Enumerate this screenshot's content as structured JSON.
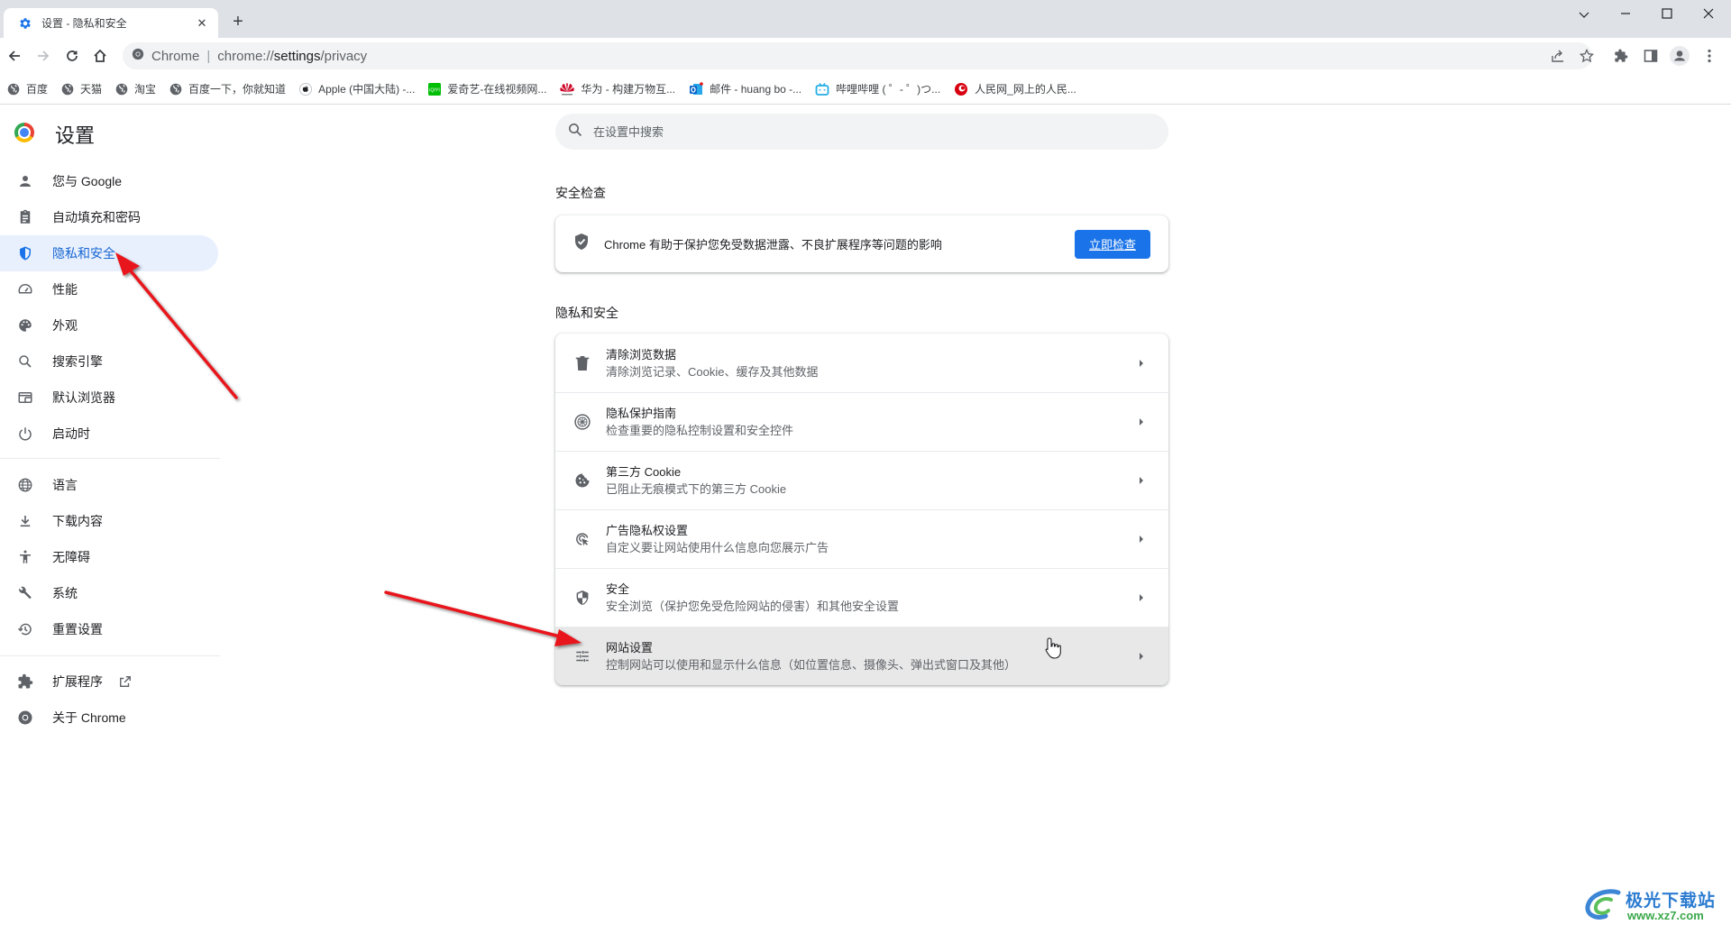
{
  "browser": {
    "tab_title": "设置 - 隐私和安全",
    "tab_icon": "gear-icon",
    "new_tab_label": "+",
    "omnibox": {
      "site_name": "Chrome",
      "separator": "|",
      "url_prefix": "chrome://",
      "url_host": "settings",
      "url_path": "/privacy"
    },
    "bookmarks": [
      {
        "label": "百度",
        "icon": "globe-icon",
        "color": "#5f6368"
      },
      {
        "label": "天猫",
        "icon": "globe-icon",
        "color": "#5f6368"
      },
      {
        "label": "淘宝",
        "icon": "globe-icon",
        "color": "#5f6368"
      },
      {
        "label": "百度一下，你就知道",
        "icon": "globe-icon",
        "color": "#5f6368"
      },
      {
        "label": "Apple (中国大陆) -...",
        "icon": "apple-icon",
        "color": "#3c4043"
      },
      {
        "label": "爱奇艺-在线视频网...",
        "icon": "iqiyi-icon",
        "color": "#00be06"
      },
      {
        "label": "华为 - 构建万物互...",
        "icon": "huawei-icon",
        "color": "#cf0a2c"
      },
      {
        "label": "邮件 - huang bo -...",
        "icon": "outlook-icon",
        "color": "#0a64c8"
      },
      {
        "label": "哔哩哔哩 ( ゜- ゜)つ...",
        "icon": "bilibili-icon",
        "color": "#23ade5"
      },
      {
        "label": "人民网_网上的人民...",
        "icon": "people-daily-icon",
        "color": "#d7000f"
      }
    ]
  },
  "settings": {
    "title": "设置",
    "search_placeholder": "在设置中搜索",
    "sidebar": [
      {
        "label": "您与 Google",
        "icon": "person-icon",
        "active": false
      },
      {
        "label": "自动填充和密码",
        "icon": "clipboard-icon",
        "active": false
      },
      {
        "label": "隐私和安全",
        "icon": "shield-icon",
        "active": true
      },
      {
        "label": "性能",
        "icon": "speedometer-icon",
        "active": false
      },
      {
        "label": "外观",
        "icon": "palette-icon",
        "active": false
      },
      {
        "label": "搜索引擎",
        "icon": "search-icon",
        "active": false
      },
      {
        "label": "默认浏览器",
        "icon": "browser-window-icon",
        "active": false
      },
      {
        "label": "启动时",
        "icon": "power-icon",
        "active": false
      },
      {
        "label": "语言",
        "icon": "globe-icon",
        "active": false
      },
      {
        "label": "下载内容",
        "icon": "download-icon",
        "active": false
      },
      {
        "label": "无障碍",
        "icon": "accessibility-icon",
        "active": false
      },
      {
        "label": "系统",
        "icon": "wrench-icon",
        "active": false
      },
      {
        "label": "重置设置",
        "icon": "history-icon",
        "active": false
      },
      {
        "label": "扩展程序",
        "icon": "puzzle-icon",
        "active": false,
        "external": true
      },
      {
        "label": "关于 Chrome",
        "icon": "chrome-icon",
        "active": false
      }
    ],
    "safety_check": {
      "heading": "安全检查",
      "text": "Chrome 有助于保护您免受数据泄露、不良扩展程序等问题的影响",
      "button": "立即检查"
    },
    "privacy": {
      "heading": "隐私和安全",
      "rows": [
        {
          "title": "清除浏览数据",
          "subtitle": "清除浏览记录、Cookie、缓存及其他数据",
          "icon": "trash-icon"
        },
        {
          "title": "隐私保护指南",
          "subtitle": "检查重要的隐私控制设置和安全控件",
          "icon": "compass-icon"
        },
        {
          "title": "第三方 Cookie",
          "subtitle": "已阻止无痕模式下的第三方 Cookie",
          "icon": "cookie-icon"
        },
        {
          "title": "广告隐私权设置",
          "subtitle": "自定义要让网站使用什么信息向您展示广告",
          "icon": "ad-privacy-icon"
        },
        {
          "title": "安全",
          "subtitle": "安全浏览（保护您免受危险网站的侵害）和其他安全设置",
          "icon": "security-shield-icon"
        },
        {
          "title": "网站设置",
          "subtitle": "控制网站可以使用和显示什么信息（如位置信息、摄像头、弹出式窗口及其他）",
          "icon": "tune-icon",
          "hovered": true
        }
      ]
    }
  },
  "watermark": {
    "name": "极光下载站",
    "url": "www.xz7.com"
  },
  "colors": {
    "accent": "#1a73e8",
    "active_nav_bg": "#e8f0fe",
    "annotation_arrow": "#e8141a"
  }
}
